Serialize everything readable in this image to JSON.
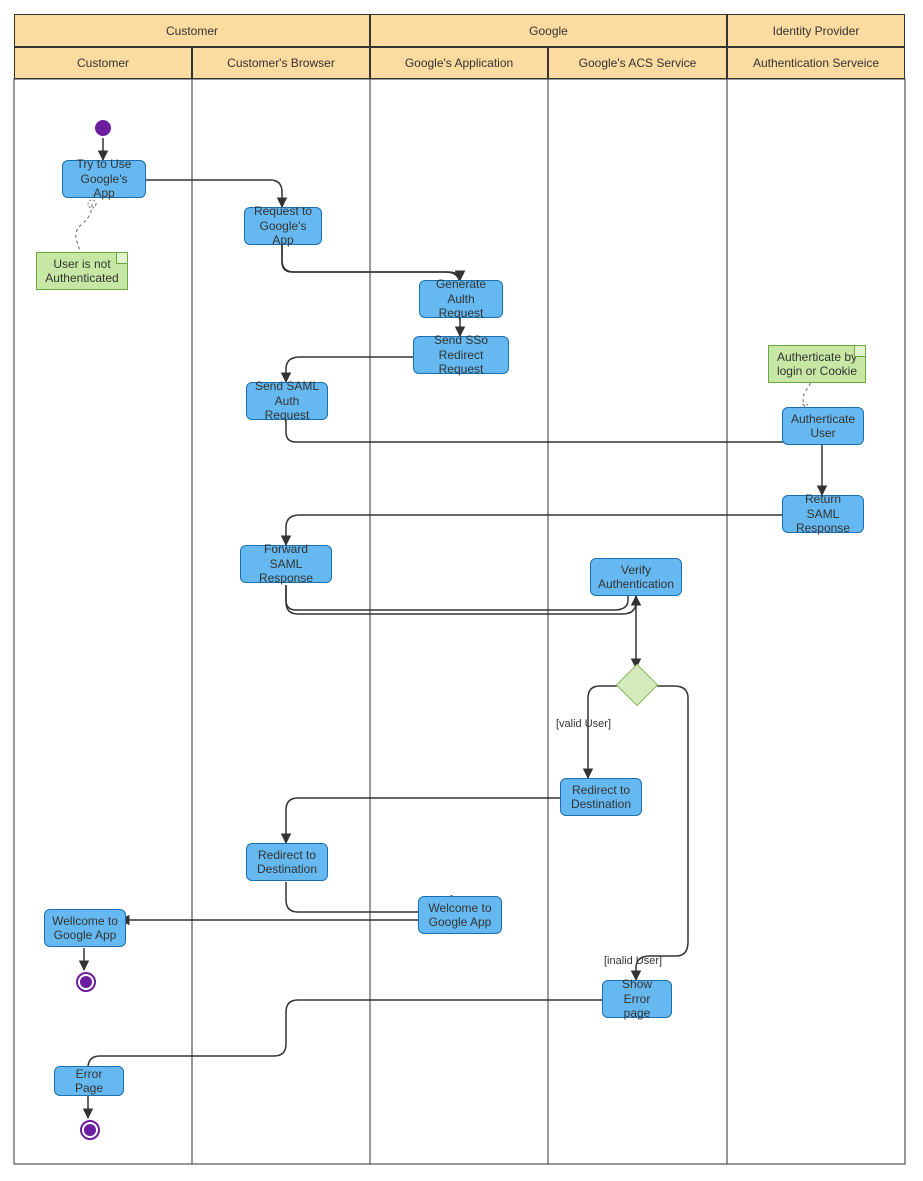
{
  "swimlanes": {
    "columns_top": {
      "customer": "Customer",
      "google": "Google",
      "idp": "Identity Provider"
    },
    "columns_sub": {
      "customer": "Customer",
      "browser": "Customer's Browser",
      "google_app": "Google's Application",
      "google_acs": "Google's ACS Service",
      "auth_service": "Authentication Serveice"
    }
  },
  "activities": {
    "try_use": "Try to Use Google's App",
    "request_app": "Request to Google's App",
    "gen_auth": "Generate Aulth Request",
    "send_sso": "Send SSo Redirect Request",
    "send_saml": "Send SAML Auth Request",
    "auth_user": "Autherticate User",
    "return_saml": "Return SAML Response",
    "forward_saml": "Forward SAML Response",
    "verify_auth": "Verify Authentication",
    "redirect_dest_acs": "Redirect to Destination",
    "redirect_dest_br": "Redirect to Destination",
    "welcome_app": "Welcome to Google App",
    "wellcome_cust": "Wellcome to Google App",
    "show_error": "Show Error page",
    "error_page": "Error Page"
  },
  "notes": {
    "not_auth": "User is not Authenticated",
    "auth_by": "Autherticate by login or Cookie"
  },
  "guards": {
    "valid": "[valid User]",
    "invalid": "[inalid User]"
  },
  "colors": {
    "lane_header": "#fbdba0",
    "activity": "#66b9f0",
    "note": "#c7e8a5",
    "diamond": "#d4eabd",
    "point": "#6b1e9e"
  }
}
